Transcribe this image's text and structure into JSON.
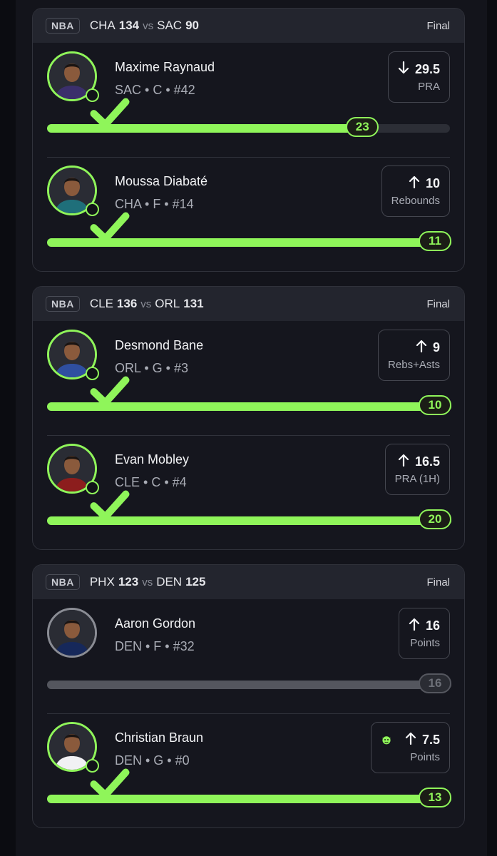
{
  "theme": {
    "accent": "#8ff55a",
    "muted": "#54565e",
    "card": "#15161e",
    "header": "#23252e"
  },
  "games": [
    {
      "league": "NBA",
      "team1": "CHA",
      "score1": "134",
      "vs": "vs",
      "team2": "SAC",
      "score2": "90",
      "status": "Final",
      "picks": [
        {
          "name": "Maxime Raynaud",
          "meta": "SAC • C • #42",
          "direction": "down",
          "line": "29.5",
          "stat": "PRA",
          "actual": "23",
          "progress": 0.78,
          "hit": true,
          "goblin": false
        },
        {
          "name": "Moussa Diabaté",
          "meta": "CHA • F • #14",
          "direction": "up",
          "line": "10",
          "stat": "Rebounds",
          "actual": "11",
          "progress": 1.0,
          "hit": true,
          "goblin": false
        }
      ]
    },
    {
      "league": "NBA",
      "team1": "CLE",
      "score1": "136",
      "vs": "vs",
      "team2": "ORL",
      "score2": "131",
      "status": "Final",
      "picks": [
        {
          "name": "Desmond Bane",
          "meta": "ORL • G • #3",
          "direction": "up",
          "line": "9",
          "stat": "Rebs+Asts",
          "actual": "10",
          "progress": 1.0,
          "hit": true,
          "goblin": false
        },
        {
          "name": "Evan Mobley",
          "meta": "CLE • C • #4",
          "direction": "up",
          "line": "16.5",
          "stat": "PRA (1H)",
          "actual": "20",
          "progress": 1.0,
          "hit": true,
          "goblin": false
        }
      ]
    },
    {
      "league": "NBA",
      "team1": "PHX",
      "score1": "123",
      "vs": "vs",
      "team2": "DEN",
      "score2": "125",
      "status": "Final",
      "picks": [
        {
          "name": "Aaron Gordon",
          "meta": "DEN • F • #32",
          "direction": "up",
          "line": "16",
          "stat": "Points",
          "actual": "16",
          "progress": 1.0,
          "hit": false,
          "goblin": false
        },
        {
          "name": "Christian Braun",
          "meta": "DEN • G • #0",
          "direction": "up",
          "line": "7.5",
          "stat": "Points",
          "actual": "13",
          "progress": 1.0,
          "hit": true,
          "goblin": true
        }
      ]
    }
  ]
}
